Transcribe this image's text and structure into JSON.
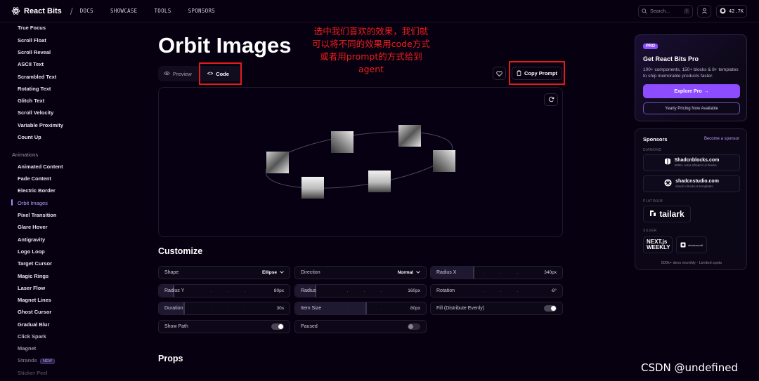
{
  "nav": {
    "brand": "React Bits",
    "separator": "/",
    "links": [
      "DOCS",
      "SHOWCASE",
      "TOOLS",
      "SPONSORS"
    ],
    "search_placeholder": "Search...",
    "search_shortcut": "/",
    "github_stars": "42.7K"
  },
  "sidebar": {
    "items": [
      "True Focus",
      "Scroll Float",
      "Scroll Reveal",
      "ASCII Text",
      "Scrambled Text",
      "Rotating Text",
      "Glitch Text",
      "Scroll Velocity",
      "Variable Proximity",
      "Count Up"
    ],
    "section": "Animations",
    "anim_items": [
      "Animated Content",
      "Fade Content",
      "Electric Border",
      "Orbit Images",
      "Pixel Transition",
      "Glare Hover",
      "Antigravity",
      "Logo Loop",
      "Target Cursor",
      "Magic Rings",
      "Laser Flow",
      "Magnet Lines",
      "Ghost Cursor",
      "Gradual Blur",
      "Click Spark",
      "Magnet",
      "Strands",
      "Sticker Peel"
    ],
    "active": "Orbit Images",
    "new_badge": "NEW"
  },
  "main": {
    "title": "Orbit Images",
    "tab_preview": "Preview",
    "tab_code": "Code",
    "copy_prompt": "Copy Prompt",
    "customize_title": "Customize",
    "props_title": "Props",
    "controls": {
      "shape_label": "Shape",
      "shape_value": "Ellipse",
      "direction_label": "Direction",
      "direction_value": "Normal",
      "radiusx_label": "Radius X",
      "radiusx_value": "340px",
      "radiusx_level": 0.33,
      "radiusy_label": "Radius Y",
      "radiusy_value": "80px",
      "radiusy_level": 0.12,
      "radius_label": "Radius",
      "radius_value": "160px",
      "radius_level": 0.16,
      "rotation_label": "Rotation",
      "rotation_value": "-8°",
      "duration_label": "Duration",
      "duration_value": "30s",
      "duration_level": 0.2,
      "itemsize_label": "Item Size",
      "itemsize_value": "80px",
      "itemsize_level": 0.55,
      "fill_label": "Fill (Distribute Evenly)",
      "showpath_label": "Show Path",
      "paused_label": "Paused"
    }
  },
  "annotation": {
    "lines": [
      "选中我们喜欢的效果，我们就",
      "可以将不同的效果用code方式",
      "或者用prompt的方式给到",
      "agent"
    ],
    "color": "#f01e1e"
  },
  "pro": {
    "badge": "PRO",
    "title": "Get React Bits Pro",
    "desc": "100+ components, 150+ blocks & 8+ templates to ship memorable products faster.",
    "cta": "Explore Pro",
    "secondary": "Yearly Pricing Now Available",
    "accent": "#8d4cff"
  },
  "sponsors": {
    "title": "Sponsors",
    "become": "Become a sponsor",
    "tier_diamond": "DIAMOND",
    "s1_name": "Shadcnblocks.com",
    "s1_sub": "2000+ extra Shadcn UI blocks",
    "s2_name": "shadcnstudio.com",
    "s2_sub": "shadcn blocks & templates",
    "tier_platinum": "PLATINUM",
    "s3_name": "tailark",
    "tier_silver": "SILVER",
    "s4_line1": "NEXT.js",
    "s4_line2": "WEEKLY",
    "s5_name": "shadcncraft",
    "footer": "500k+ devs monthly · Limited spots"
  },
  "watermark": "CSDN @undefined"
}
